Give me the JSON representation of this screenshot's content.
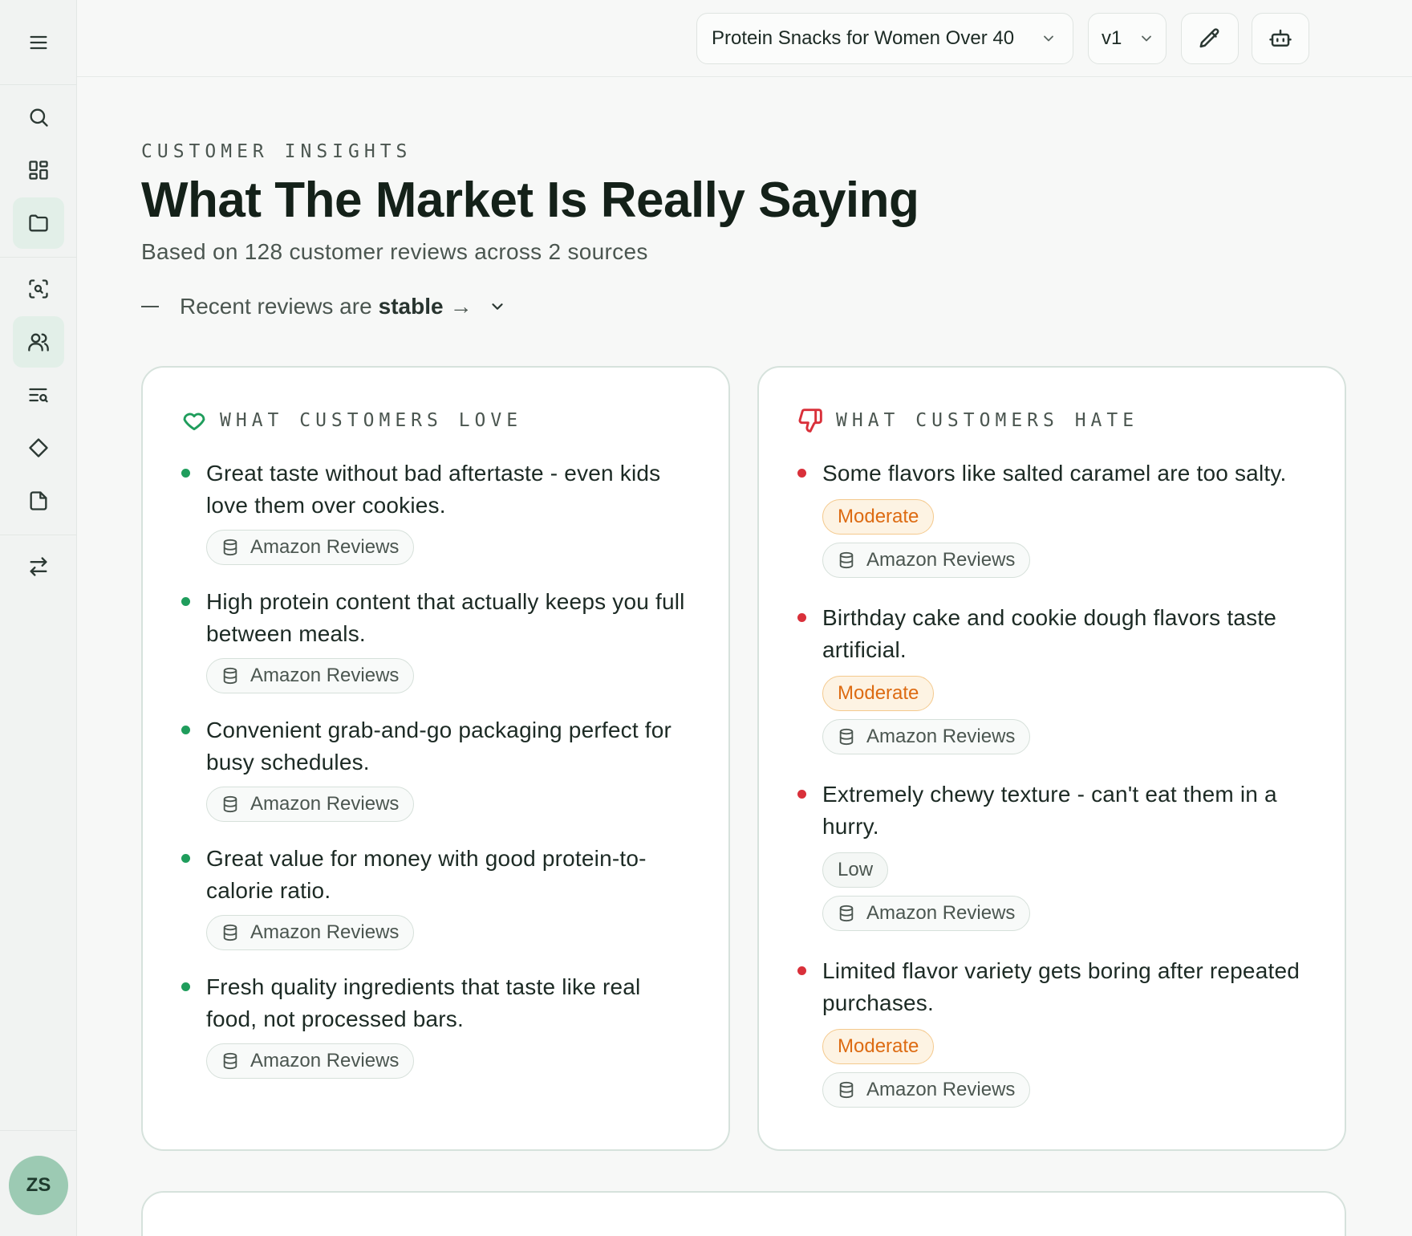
{
  "sidebar": {
    "items": [
      {
        "name": "search",
        "icon": "search-icon",
        "active": false
      },
      {
        "name": "dashboard",
        "icon": "grid-icon",
        "active": false
      },
      {
        "name": "projects",
        "icon": "folder-icon",
        "active": true
      },
      {
        "name": "scan",
        "icon": "scan-search-icon",
        "active": false
      },
      {
        "name": "customers",
        "icon": "users-icon",
        "active": true
      },
      {
        "name": "search-list",
        "icon": "list-search-icon",
        "active": false
      },
      {
        "name": "tags",
        "icon": "diamond-icon",
        "active": false
      },
      {
        "name": "documents",
        "icon": "file-icon",
        "active": false
      },
      {
        "name": "compare",
        "icon": "swap-icon",
        "active": false
      }
    ],
    "avatar_initials": "ZS"
  },
  "header": {
    "project_select": "Protein Snacks for Women Over 40",
    "version_select": "v1"
  },
  "page": {
    "eyebrow": "CUSTOMER INSIGHTS",
    "title": "What The Market Is Really Saying",
    "subtitle": "Based on 128 customer reviews across 2 sources",
    "trend_prefix": "Recent reviews are",
    "trend_value": "stable",
    "trend_arrow": "→"
  },
  "love": {
    "heading": "WHAT CUSTOMERS LOVE",
    "accent": "#1f9d5c",
    "items": [
      {
        "text": "Great taste without bad aftertaste - even kids love them over cookies.",
        "source": "Amazon Reviews"
      },
      {
        "text": "High protein content that actually keeps you full between meals.",
        "source": "Amazon Reviews"
      },
      {
        "text": "Convenient grab-and-go packaging perfect for busy schedules.",
        "source": "Amazon Reviews"
      },
      {
        "text": "Great value for money with good protein-to-calorie ratio.",
        "source": "Amazon Reviews"
      },
      {
        "text": "Fresh quality ingredients that taste like real food, not processed bars.",
        "source": "Amazon Reviews"
      }
    ]
  },
  "hate": {
    "heading": "WHAT CUSTOMERS HATE",
    "accent": "#d9303a",
    "items": [
      {
        "text": "Some flavors like salted caramel are too salty.",
        "severity": "Moderate",
        "source": "Amazon Reviews"
      },
      {
        "text": "Birthday cake and cookie dough flavors taste artificial.",
        "severity": "Moderate",
        "source": "Amazon Reviews"
      },
      {
        "text": "Extremely chewy texture - can't eat them in a hurry.",
        "severity": "Low",
        "source": "Amazon Reviews"
      },
      {
        "text": "Limited flavor variety gets boring after repeated purchases.",
        "severity": "Moderate",
        "source": "Amazon Reviews"
      }
    ]
  }
}
